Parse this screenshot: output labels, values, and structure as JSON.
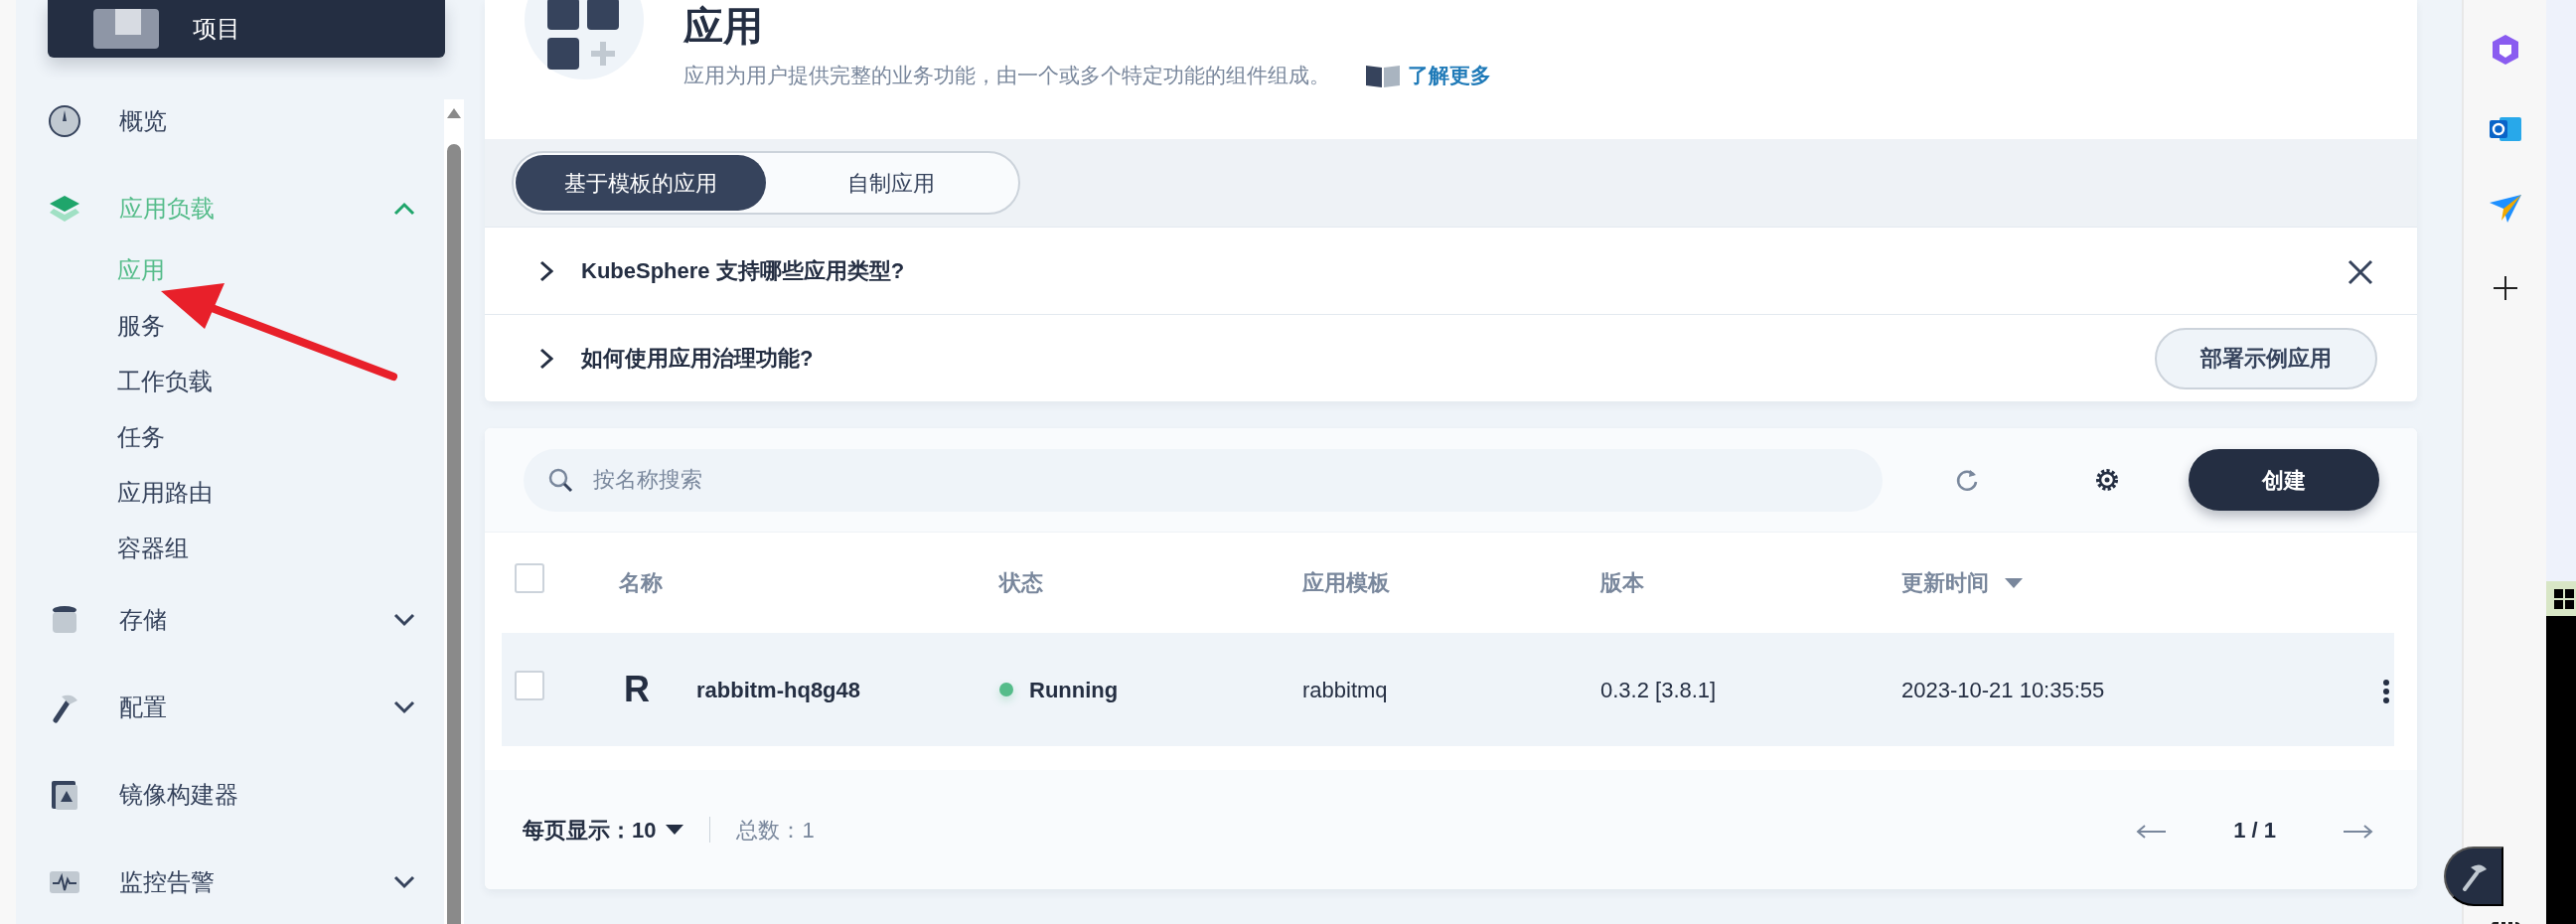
{
  "project_card": {
    "label": "项目"
  },
  "sidebar": {
    "items": [
      {
        "label": "概览",
        "selected": false
      },
      {
        "label": "应用负载",
        "selected": true,
        "expanded": true,
        "children": [
          {
            "label": "应用",
            "selected": true
          },
          {
            "label": "服务",
            "selected": false
          },
          {
            "label": "工作负载",
            "selected": false
          },
          {
            "label": "任务",
            "selected": false
          },
          {
            "label": "应用路由",
            "selected": false
          },
          {
            "label": "容器组",
            "selected": false
          }
        ]
      },
      {
        "label": "存储",
        "selected": false,
        "expanded": false
      },
      {
        "label": "配置",
        "selected": false,
        "expanded": false
      },
      {
        "label": "镜像构建器",
        "selected": false
      },
      {
        "label": "监控告警",
        "selected": false,
        "expanded": false
      }
    ]
  },
  "header": {
    "title": "应用",
    "description": "应用为用户提供完整的业务功能，由一个或多个特定功能的组件组成。",
    "learn_more": "了解更多"
  },
  "tabs": [
    {
      "label": "基于模板的应用",
      "selected": true
    },
    {
      "label": "自制应用",
      "selected": false
    }
  ],
  "faq": [
    {
      "question": "KubeSphere 支持哪些应用类型?",
      "action": {
        "kind": "close"
      }
    },
    {
      "question": "如何使用应用治理功能?",
      "action": {
        "kind": "button",
        "label": "部署示例应用"
      }
    }
  ],
  "toolbar": {
    "search_placeholder": "按名称搜索",
    "create_label": "创建"
  },
  "table": {
    "all_checked": false,
    "columns": [
      {
        "label": "名称"
      },
      {
        "label": "状态"
      },
      {
        "label": "应用模板"
      },
      {
        "label": "版本"
      },
      {
        "label": "更新时间",
        "sortable": true
      }
    ],
    "rows": [
      {
        "checked": false,
        "avatar": "R",
        "name": "rabbitm-hq8g48",
        "status": "Running",
        "color": "#55bc8a",
        "template": "rabbitmq",
        "version": "0.3.2 [3.8.1]",
        "updated": "2023-10-21 10:35:55"
      }
    ]
  },
  "pagination": {
    "page_size_label": "每页显示：",
    "page_size": "10",
    "total": "总数：1",
    "pages": "1 / 1"
  }
}
